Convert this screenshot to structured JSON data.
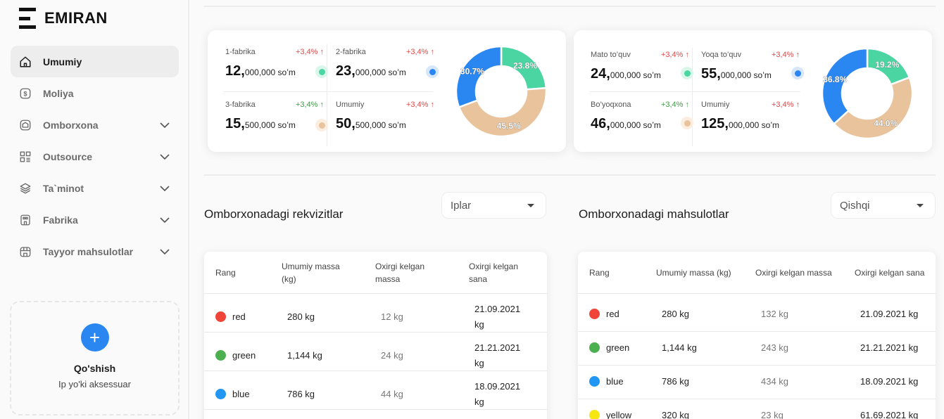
{
  "brand": {
    "name": "EMIRAN"
  },
  "sidebar": {
    "items": [
      {
        "label": "Umumiy",
        "icon": "home-icon",
        "active": true,
        "expandable": false
      },
      {
        "label": "Moliya",
        "icon": "dollar-icon",
        "active": false,
        "expandable": false
      },
      {
        "label": "Omborxona",
        "icon": "warehouse-icon",
        "active": false,
        "expandable": true
      },
      {
        "label": "Outsource",
        "icon": "grid-icon",
        "active": false,
        "expandable": true
      },
      {
        "label": "Ta`minot",
        "icon": "layers-icon",
        "active": false,
        "expandable": true
      },
      {
        "label": "Fabrika",
        "icon": "factory-icon",
        "active": false,
        "expandable": true
      },
      {
        "label": "Tayyor mahsulotlar",
        "icon": "store-icon",
        "active": false,
        "expandable": true
      }
    ],
    "add": {
      "button": "+",
      "title": "Qo'shish",
      "subtitle": "Ip yo'ki aksessuar"
    }
  },
  "colors": {
    "green": "#4bd5a3",
    "blue": "#2a86f1",
    "beige": "#e9c39b",
    "red_delta": "#e04848",
    "green_delta": "#3f9b48"
  },
  "cards": [
    {
      "stats": [
        {
          "label": "1-fabrika",
          "delta": "+3,4% ↑",
          "delta_color": "red",
          "big": "12,",
          "small": "000,000 so’m",
          "dot": "green"
        },
        {
          "label": "2-fabrika",
          "delta": "+3,4% ↑",
          "delta_color": "red",
          "big": "23,",
          "small": "000,000 so’m",
          "dot": "blue"
        },
        {
          "label": "3-fabrika",
          "delta": "+3,4% ↑",
          "delta_color": "green",
          "big": "15,",
          "small": "500,000 so’m",
          "dot": "beige"
        },
        {
          "label": "Umumiy",
          "delta": "+3,4% ↑",
          "delta_color": "red",
          "big": "50,",
          "small": "500,000 so’m",
          "dot": ""
        }
      ],
      "donut": [
        {
          "label": "23.8%",
          "value": 23.8,
          "color": "green"
        },
        {
          "label": "45.5%",
          "value": 45.5,
          "color": "beige"
        },
        {
          "label": "30.7%",
          "value": 30.7,
          "color": "blue"
        }
      ]
    },
    {
      "stats": [
        {
          "label": "Mato to’quv",
          "delta": "+3,4% ↑",
          "delta_color": "red",
          "big": "24,",
          "small": "000,000 so’m",
          "dot": "green"
        },
        {
          "label": "Yoqa to’quv",
          "delta": "+3,4% ↑",
          "delta_color": "red",
          "big": "55,",
          "small": "000,000 so’m",
          "dot": "blue"
        },
        {
          "label": "Bo’yoqxona",
          "delta": "+3,4% ↑",
          "delta_color": "green",
          "big": "46,",
          "small": "000,000 so’m",
          "dot": "beige"
        },
        {
          "label": "Umumiy",
          "delta": "+3,4% ↑",
          "delta_color": "red",
          "big": "125,",
          "small": "000,000 so’m",
          "dot": ""
        }
      ],
      "donut": [
        {
          "label": "19.2%",
          "value": 19.2,
          "color": "green"
        },
        {
          "label": "44.0%",
          "value": 44.0,
          "color": "beige"
        },
        {
          "label": "36.8%",
          "value": 36.8,
          "color": "blue"
        }
      ]
    }
  ],
  "sections": [
    {
      "title": "Omborxonadagi rekvizitlar",
      "select": "Iplar",
      "headers": [
        "Rang",
        "Umumiy massa (kg)",
        "Oxirgi kelgan massa",
        "Oxirgi kelgan sana"
      ],
      "rows": [
        {
          "color": "#f04438",
          "name": "red",
          "mass": "280 kg",
          "last_mass": "12 kg",
          "date": "21.09.2021 kg"
        },
        {
          "color": "#4caf50",
          "name": "green",
          "mass": "1,144 kg",
          "last_mass": "24 kg",
          "date": "21.21.2021 kg"
        },
        {
          "color": "#2196f3",
          "name": "blue",
          "mass": "786 kg",
          "last_mass": "44 kg",
          "date": "18.09.2021 kg"
        }
      ]
    },
    {
      "title": "Omborxonadagi mahsulotlar",
      "select": "Qishqi",
      "headers": [
        "Rang",
        "Umumiy massa (kg)",
        "Oxirgi kelgan massa",
        "Oxirgi kelgan sana"
      ],
      "rows": [
        {
          "color": "#f04438",
          "name": "red",
          "mass": "280 kg",
          "last_mass": "132 kg",
          "date": "21.09.2021 kg"
        },
        {
          "color": "#4caf50",
          "name": "green",
          "mass": "1,144 kg",
          "last_mass": "243 kg",
          "date": "21.21.2021 kg"
        },
        {
          "color": "#2196f3",
          "name": "blue",
          "mass": "786 kg",
          "last_mass": "434 kg",
          "date": "18.09.2021 kg"
        },
        {
          "color": "#f5e614",
          "name": "yellow",
          "mass": "320 kg",
          "last_mass": "23 kg",
          "date": "61.69.2021 kg"
        }
      ]
    }
  ]
}
